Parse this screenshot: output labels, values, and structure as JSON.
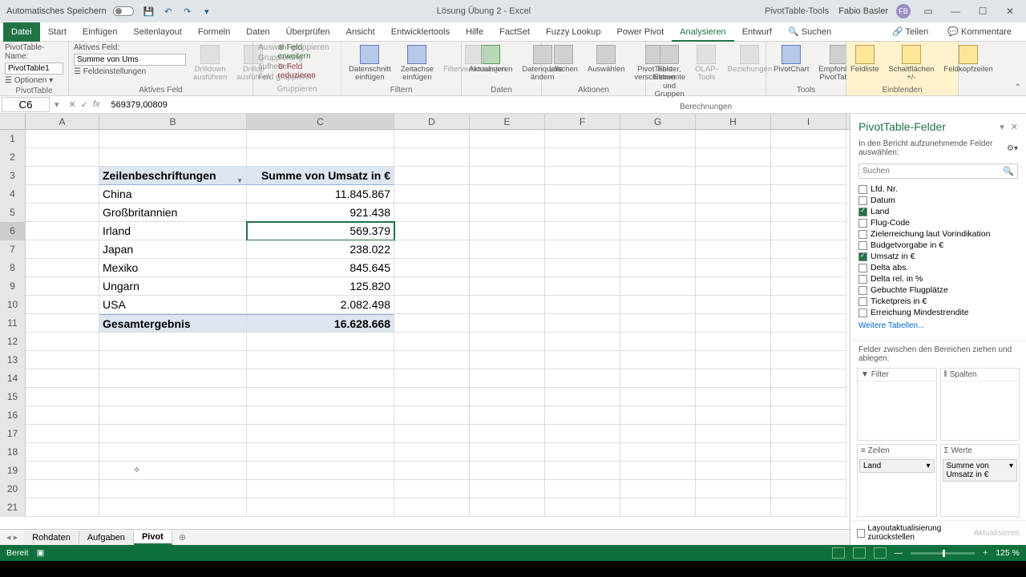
{
  "titlebar": {
    "autosave": "Automatisches Speichern",
    "doc": "Lösung Übung 2 - Excel",
    "contextual": "PivotTable-Tools",
    "user": "Fabio Basler",
    "userInitials": "FB"
  },
  "tabs": {
    "file": "Datei",
    "items": [
      "Start",
      "Einfügen",
      "Seitenlayout",
      "Formeln",
      "Daten",
      "Überprüfen",
      "Ansicht",
      "Entwicklertools",
      "Hilfe",
      "FactSet",
      "Fuzzy Lookup",
      "Power Pivot"
    ],
    "ctx": [
      "Analysieren",
      "Entwurf"
    ],
    "search": "Suchen",
    "share": "Teilen",
    "comments": "Kommentare"
  },
  "ribbon": {
    "g1": {
      "label": "PivotTable",
      "l1": "PivotTable-Name:",
      "v1": "PivotTable1",
      "opt": "Optionen"
    },
    "g2": {
      "label": "Aktives Feld",
      "l1": "Aktives Feld:",
      "v1": "Summe von Ums",
      "fs": "Feldeinstellungen",
      "dd": "Drilldown ausführen",
      "du": "Drillup ausführen",
      "fe": "Feld erweitern",
      "fr": "Feld reduzieren"
    },
    "g3": {
      "label": "Gruppieren",
      "a": "Auswahl gruppieren",
      "b": "Gruppierung aufheben",
      "c": "Feld gruppieren"
    },
    "g4": {
      "label": "Filtern",
      "a": "Datenschnitt einfügen",
      "b": "Zeitachse einfügen",
      "c": "Filterverbindungen"
    },
    "g5": {
      "label": "Daten",
      "a": "Aktualisieren",
      "b": "Datenquelle ändern"
    },
    "g6": {
      "label": "Aktionen",
      "a": "Löschen",
      "b": "Auswählen",
      "c": "PivotTable verschieben"
    },
    "g7": {
      "label": "Berechnungen",
      "a": "Felder, Elemente und Gruppen",
      "b": "OLAP-Tools",
      "c": "Beziehungen"
    },
    "g8": {
      "label": "Tools",
      "a": "PivotChart",
      "b": "Empfohlene PivotTables"
    },
    "g9": {
      "label": "Einblenden",
      "a": "Feldliste",
      "b": "Schaltflächen +/-",
      "c": "Feldkopfzeilen"
    }
  },
  "fbar": {
    "name": "C6",
    "formula": "569379,00809"
  },
  "cols": [
    "A",
    "B",
    "C",
    "D",
    "E",
    "F",
    "G",
    "H",
    "I"
  ],
  "pivot": {
    "rowHeader": "Zeilenbeschriftungen",
    "valHeader": "Summe von Umsatz in €",
    "rows": [
      {
        "label": "China",
        "val": "11.845.867"
      },
      {
        "label": "Großbritannien",
        "val": "921.438"
      },
      {
        "label": "Irland",
        "val": "569.379"
      },
      {
        "label": "Japan",
        "val": "238.022"
      },
      {
        "label": "Mexiko",
        "val": "845.645"
      },
      {
        "label": "Ungarn",
        "val": "125.820"
      },
      {
        "label": "USA",
        "val": "2.082.498"
      }
    ],
    "totalLabel": "Gesamtergebnis",
    "totalVal": "16.628.668"
  },
  "sheets": {
    "items": [
      "Rohdaten",
      "Aufgaben",
      "Pivot"
    ],
    "activeIndex": 2
  },
  "fieldpane": {
    "title": "PivotTable-Felder",
    "sub": "In den Bericht aufzunehmende Felder auswählen:",
    "search": "Suchen",
    "fields": [
      {
        "name": "Lfd. Nr.",
        "on": false
      },
      {
        "name": "Datum",
        "on": false
      },
      {
        "name": "Land",
        "on": true
      },
      {
        "name": "Flug-Code",
        "on": false
      },
      {
        "name": "Zielerreichung laut Vorindikation",
        "on": false
      },
      {
        "name": "Budgetvorgabe in €",
        "on": false
      },
      {
        "name": "Umsatz in €",
        "on": true
      },
      {
        "name": "Delta abs.",
        "on": false
      },
      {
        "name": "Delta rel. in %",
        "on": false
      },
      {
        "name": "Gebuchte Flugplätze",
        "on": false
      },
      {
        "name": "Ticketpreis in €",
        "on": false
      },
      {
        "name": "Erreichung Mindestrendite",
        "on": false
      }
    ],
    "more": "Weitere Tabellen...",
    "dragLabel": "Felder zwischen den Bereichen ziehen und ablegen:",
    "areas": {
      "filter": "Filter",
      "cols": "Spalten",
      "rows": "Zeilen",
      "vals": "Werte",
      "rowItem": "Land",
      "valItem": "Summe von Umsatz in €"
    },
    "defer": "Layoutaktualisierung zurückstellen",
    "update": "Aktualisieren"
  },
  "status": {
    "ready": "Bereit",
    "zoom": "125 %"
  }
}
